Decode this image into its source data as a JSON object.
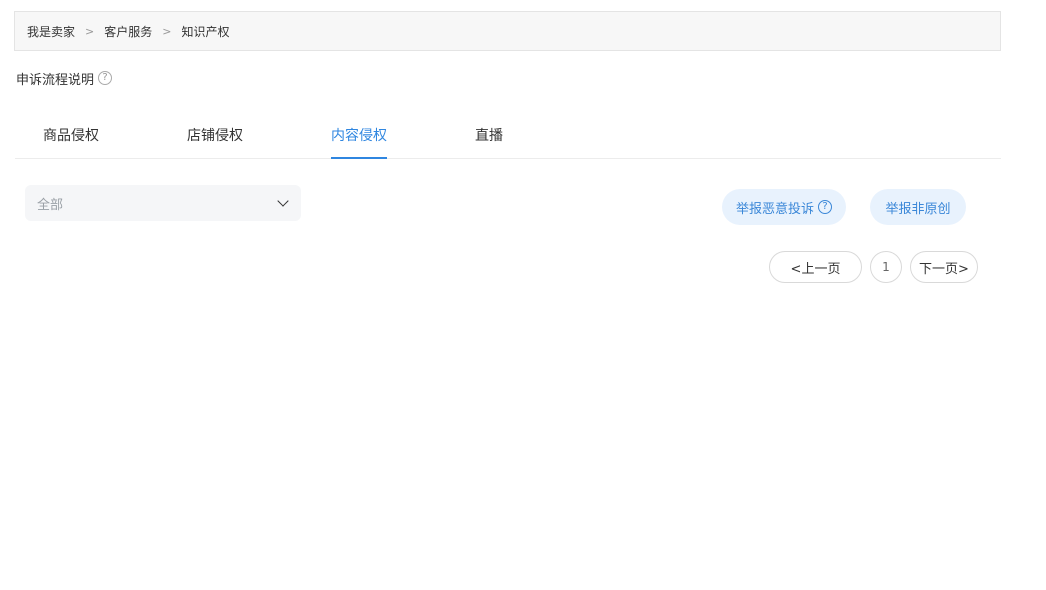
{
  "breadcrumb": {
    "items": [
      "我是卖家",
      "客户服务",
      "知识产权"
    ],
    "separator": ">"
  },
  "appeal": {
    "label": "申诉流程说明",
    "help_icon": "?"
  },
  "tabs": [
    {
      "label": "商品侵权",
      "active": false
    },
    {
      "label": "店铺侵权",
      "active": false
    },
    {
      "label": "内容侵权",
      "active": true
    },
    {
      "label": "直播",
      "active": false
    }
  ],
  "filter": {
    "selected": "全部"
  },
  "actions": {
    "report_malicious": "举报恶意投诉",
    "report_malicious_help": "?",
    "report_non_original": "举报非原创"
  },
  "pagination": {
    "prev": "<上一页",
    "current": "1",
    "next": "下一页>"
  },
  "colors": {
    "accent": "#2f86e0",
    "pill_bg": "#e8f2fd"
  }
}
